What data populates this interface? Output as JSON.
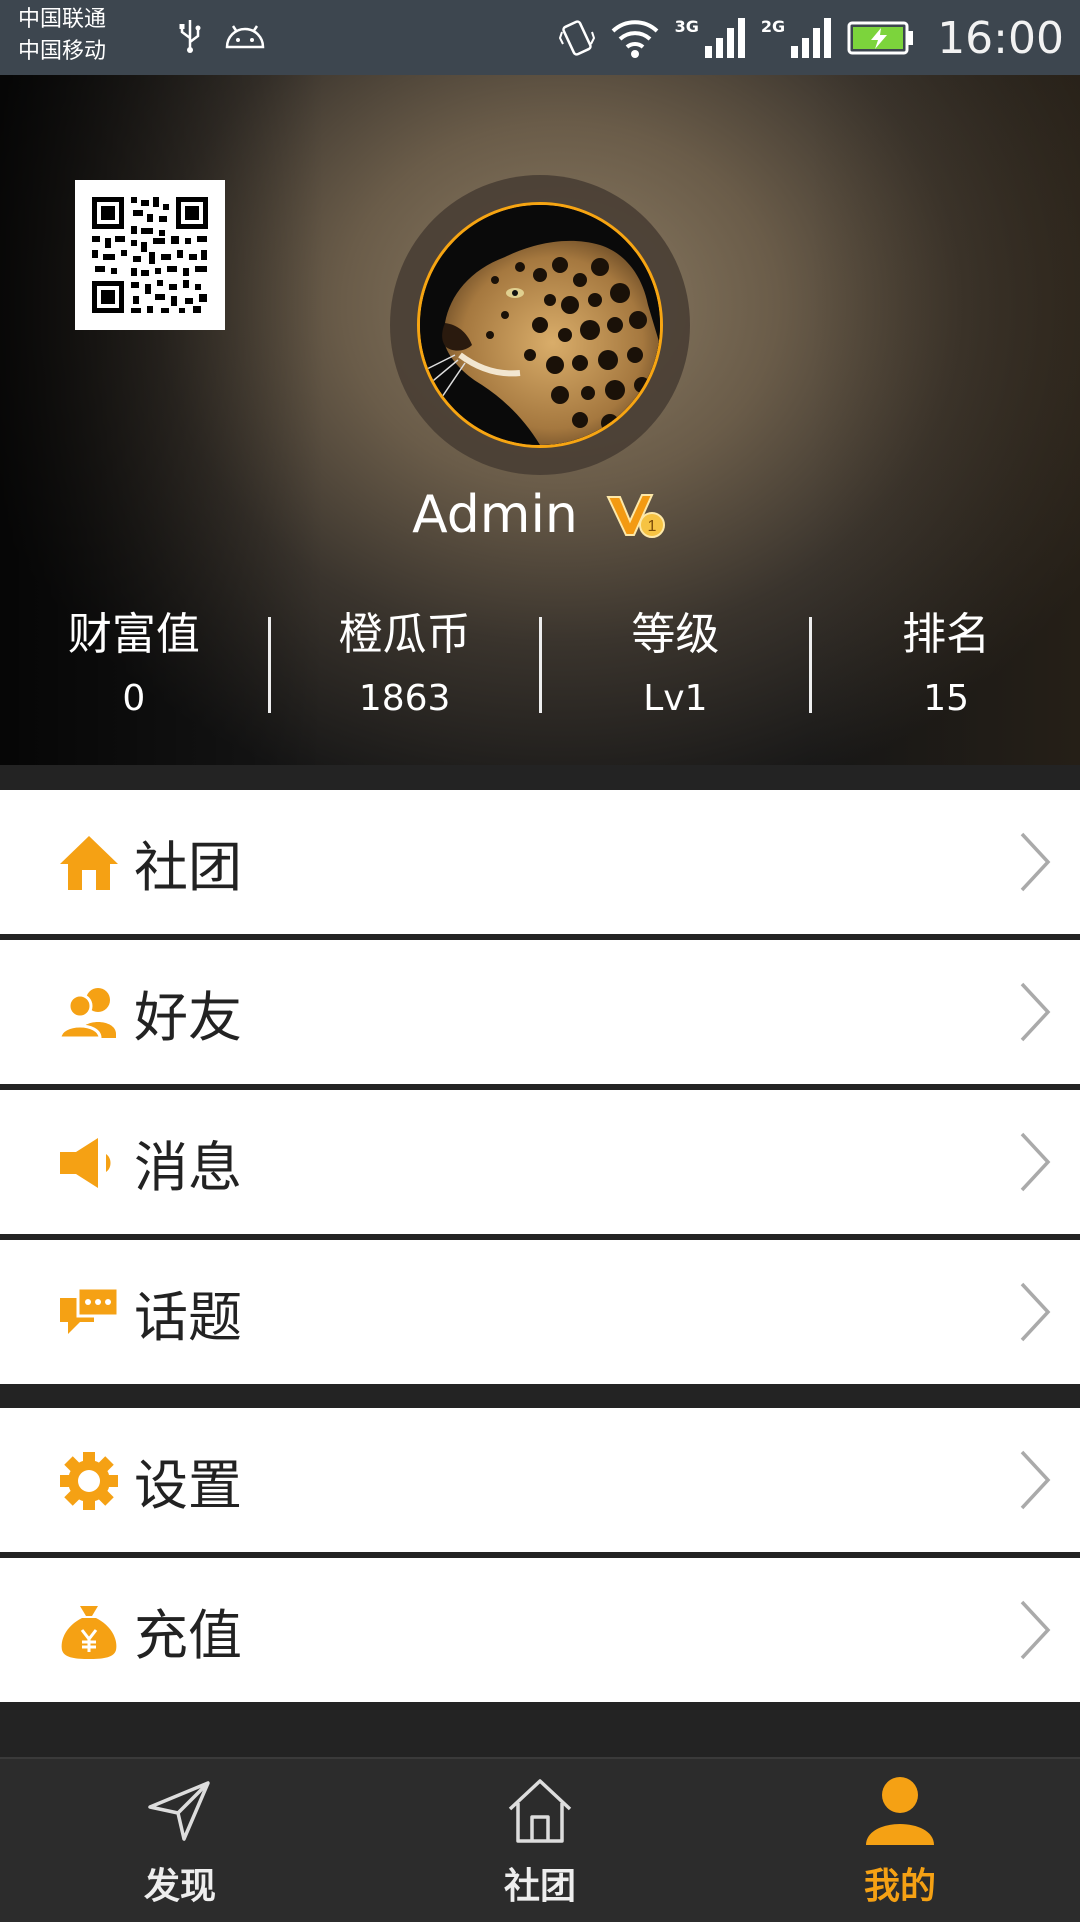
{
  "status_bar": {
    "carrier1": "中国联通",
    "carrier2": "中国移动",
    "net1": "3G",
    "net2": "2G",
    "time": "16:00"
  },
  "profile": {
    "username": "Admin",
    "vip_badge": "V",
    "vip_level": "1",
    "stats": [
      {
        "label": "财富值",
        "value": "0"
      },
      {
        "label": "橙瓜币",
        "value": "1863"
      },
      {
        "label": "等级",
        "value": "Lv1"
      },
      {
        "label": "排名",
        "value": "15"
      }
    ]
  },
  "menu": {
    "group1": [
      {
        "label": "社团",
        "icon": "house-icon"
      },
      {
        "label": "好友",
        "icon": "friends-icon"
      },
      {
        "label": "消息",
        "icon": "speaker-icon"
      },
      {
        "label": "话题",
        "icon": "chat-bubble-icon"
      }
    ],
    "group2": [
      {
        "label": "设置",
        "icon": "gear-icon"
      },
      {
        "label": "充值",
        "icon": "money-bag-icon"
      }
    ]
  },
  "tabs": [
    {
      "label": "发现",
      "icon": "paper-plane-icon",
      "active": false
    },
    {
      "label": "社团",
      "icon": "house-outline-icon",
      "active": false
    },
    {
      "label": "我的",
      "icon": "person-icon",
      "active": true
    }
  ],
  "colors": {
    "accent": "#f5a114",
    "tab_bar_bg": "#2c2c2c",
    "status_bar_bg": "#3d464f"
  }
}
